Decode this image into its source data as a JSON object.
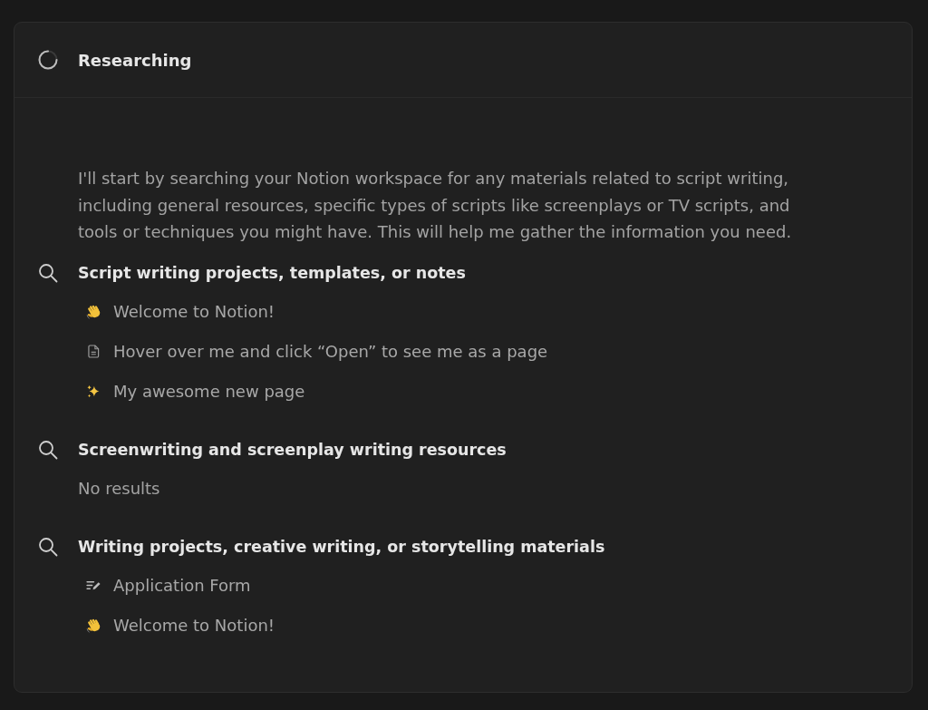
{
  "status": {
    "loading": true,
    "title": "Researching"
  },
  "message": "I'll start by searching your Notion workspace for any materials related to script writing, including general resources, specific types of scripts like screenplays or TV scripts, and tools or techniques you might have. This will help me gather the information you need.",
  "searches": [
    {
      "query": "Script writing projects, templates, or notes",
      "results": [
        {
          "kind": "wave",
          "title": "Welcome to Notion!"
        },
        {
          "kind": "document",
          "title": "Hover over me and click “Open” to see me as a page"
        },
        {
          "kind": "sparkles",
          "title": "My awesome new page"
        }
      ]
    },
    {
      "query": "Screenwriting and screenplay writing resources",
      "empty_text": "No results"
    },
    {
      "query": "Writing projects, creative writing, or storytelling materials",
      "results": [
        {
          "kind": "form",
          "title": "Application Form"
        },
        {
          "kind": "wave",
          "title": "Welcome to Notion!"
        }
      ]
    }
  ]
}
